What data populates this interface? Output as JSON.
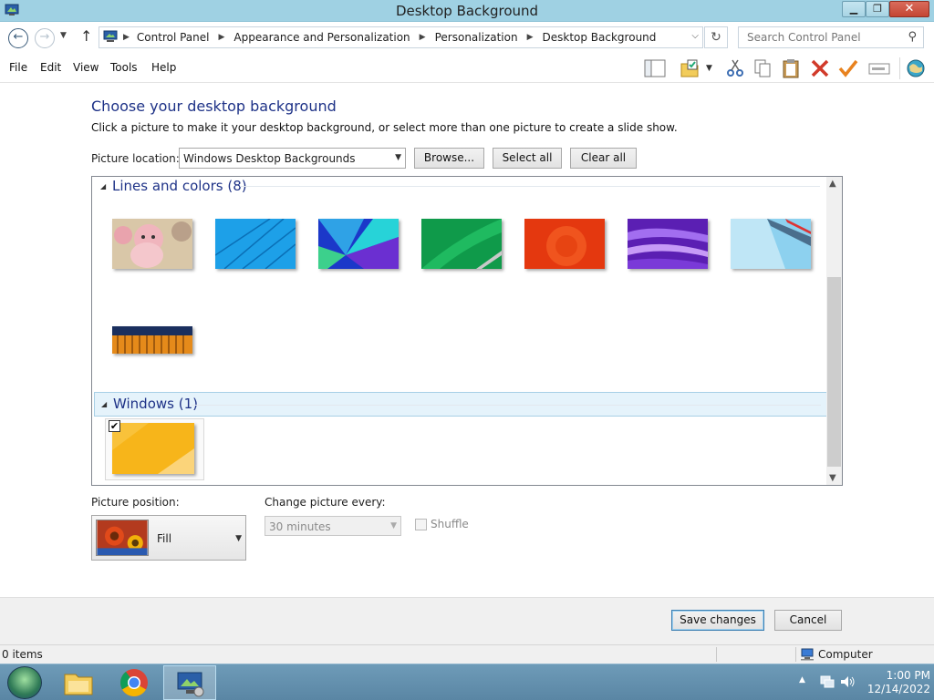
{
  "window": {
    "title": "Desktop Background"
  },
  "address": {
    "crumbs": [
      "Control Panel",
      "Appearance and Personalization",
      "Personalization",
      "Desktop Background"
    ],
    "search_placeholder": "Search Control Panel"
  },
  "menu": [
    "File",
    "Edit",
    "View",
    "Tools",
    "Help"
  ],
  "toolbar_icons": [
    "layout-icon",
    "folder-properties-icon",
    "cut-icon",
    "copy-icon",
    "paste-icon",
    "delete-icon",
    "undo-check-icon",
    "rename-icon",
    "globe-icon"
  ],
  "page": {
    "heading": "Choose your desktop background",
    "subtext": "Click a picture to make it your desktop background, or select more than one picture to create a slide show.",
    "location_label": "Picture location:",
    "location_value": "Windows Desktop Backgrounds",
    "browse": "Browse...",
    "select_all": "Select all",
    "clear_all": "Clear all"
  },
  "groups": [
    {
      "label": "Lines and colors (8)"
    },
    {
      "label": "Windows (1)"
    }
  ],
  "position": {
    "label": "Picture position:",
    "value": "Fill"
  },
  "change": {
    "label": "Change picture every:",
    "value": "30 minutes",
    "shuffle": "Shuffle"
  },
  "footer": {
    "save": "Save changes",
    "cancel": "Cancel"
  },
  "status": {
    "items": "0 items",
    "computer": "Computer"
  },
  "clock": {
    "time": "1:00 PM",
    "date": "12/14/2022"
  },
  "colors": {
    "accent": "#1e3287",
    "titlebar": "#9fd1e3",
    "taskbar": "#6e9bb8"
  }
}
